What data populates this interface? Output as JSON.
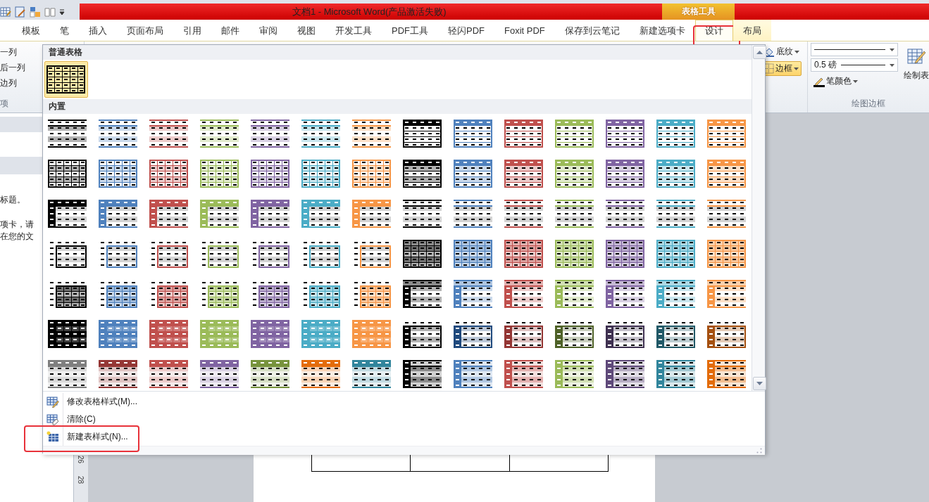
{
  "title_bar": {
    "title": "文档1  -  Microsoft Word(产品激活失败)",
    "contextual_label": "表格工具"
  },
  "tabs": [
    {
      "label": "模板",
      "selected": false,
      "contextual": false,
      "highlighted": false
    },
    {
      "label": "笔",
      "selected": false,
      "contextual": false,
      "highlighted": false
    },
    {
      "label": "插入",
      "selected": false,
      "contextual": false,
      "highlighted": false
    },
    {
      "label": "页面布局",
      "selected": false,
      "contextual": false,
      "highlighted": false
    },
    {
      "label": "引用",
      "selected": false,
      "contextual": false,
      "highlighted": false
    },
    {
      "label": "邮件",
      "selected": false,
      "contextual": false,
      "highlighted": false
    },
    {
      "label": "审阅",
      "selected": false,
      "contextual": false,
      "highlighted": false
    },
    {
      "label": "视图",
      "selected": false,
      "contextual": false,
      "highlighted": false
    },
    {
      "label": "开发工具",
      "selected": false,
      "contextual": false,
      "highlighted": false
    },
    {
      "label": "PDF工具",
      "selected": false,
      "contextual": false,
      "highlighted": false
    },
    {
      "label": "轻闪PDF",
      "selected": false,
      "contextual": false,
      "highlighted": false
    },
    {
      "label": "Foxit PDF",
      "selected": false,
      "contextual": false,
      "highlighted": false
    },
    {
      "label": "保存到云笔记",
      "selected": false,
      "contextual": false,
      "highlighted": false
    },
    {
      "label": "新建选项卡",
      "selected": false,
      "contextual": false,
      "highlighted": false
    },
    {
      "label": "设计",
      "selected": true,
      "contextual": true,
      "highlighted": true
    },
    {
      "label": "布局",
      "selected": false,
      "contextual": true,
      "highlighted": false
    }
  ],
  "ribbon": {
    "left_options": [
      "一列",
      "后一列",
      "边列"
    ],
    "left_group_label": "项",
    "shading_button": "底纹",
    "borders_button": {
      "label": "边框",
      "active": true
    },
    "line_weight": "0.5 磅",
    "pen_color": "笔颜色",
    "draw_table": "绘制表",
    "group_label": "绘图边框"
  },
  "task_pane": {
    "lines": [
      "标题。",
      "项卡，请",
      "在您的文"
    ]
  },
  "ruler": [
    "26",
    "28"
  ],
  "gallery": {
    "plain_header": "普通表格",
    "plain_items": [
      {
        "kind": "plain",
        "color": "#000000",
        "selected": true
      }
    ],
    "builtin_header": "内置",
    "rows": [
      {
        "items": [
          {
            "kind": "shading",
            "color": "#000000",
            "selected": false
          },
          {
            "kind": "shading",
            "color": "#4f81bd",
            "selected": false
          },
          {
            "kind": "shading",
            "color": "#c0504d",
            "selected": false
          },
          {
            "kind": "shading",
            "color": "#9bbb59",
            "selected": false
          },
          {
            "kind": "shading",
            "color": "#8064a2",
            "selected": false
          },
          {
            "kind": "shading",
            "color": "#4bacc6",
            "selected": false
          },
          {
            "kind": "shading",
            "color": "#f79646",
            "selected": false
          },
          {
            "kind": "list",
            "color": "#000000",
            "selected": false
          },
          {
            "kind": "list",
            "color": "#4f81bd",
            "selected": false
          },
          {
            "kind": "list",
            "color": "#c0504d",
            "selected": false
          },
          {
            "kind": "list",
            "color": "#9bbb59",
            "selected": false
          },
          {
            "kind": "list",
            "color": "#8064a2",
            "selected": false
          },
          {
            "kind": "list",
            "color": "#4bacc6",
            "selected": false
          },
          {
            "kind": "list",
            "color": "#f79646",
            "selected": false
          }
        ]
      },
      {
        "items": [
          {
            "kind": "grid",
            "color": "#000000",
            "selected": false
          },
          {
            "kind": "grid",
            "color": "#4f81bd",
            "selected": false
          },
          {
            "kind": "grid",
            "color": "#c0504d",
            "selected": false
          },
          {
            "kind": "grid",
            "color": "#9bbb59",
            "selected": false
          },
          {
            "kind": "grid",
            "color": "#8064a2",
            "selected": false
          },
          {
            "kind": "grid",
            "color": "#4bacc6",
            "selected": false
          },
          {
            "kind": "grid",
            "color": "#f79646",
            "selected": false
          },
          {
            "kind": "header",
            "color": "#000000",
            "selected": false
          },
          {
            "kind": "header",
            "color": "#4f81bd",
            "selected": false
          },
          {
            "kind": "header",
            "color": "#c0504d",
            "selected": false
          },
          {
            "kind": "header",
            "color": "#9bbb59",
            "selected": false
          },
          {
            "kind": "header",
            "color": "#8064a2",
            "selected": false
          },
          {
            "kind": "header",
            "color": "#4bacc6",
            "selected": false
          },
          {
            "kind": "header",
            "color": "#f79646",
            "selected": false
          }
        ]
      },
      {
        "items": [
          {
            "kind": "side",
            "color": "#000000",
            "selected": false
          },
          {
            "kind": "side",
            "color": "#4f81bd",
            "selected": false
          },
          {
            "kind": "side",
            "color": "#c0504d",
            "selected": false
          },
          {
            "kind": "side",
            "color": "#9bbb59",
            "selected": false
          },
          {
            "kind": "side",
            "color": "#8064a2",
            "selected": false
          },
          {
            "kind": "side",
            "color": "#4bacc6",
            "selected": false
          },
          {
            "kind": "side",
            "color": "#f79646",
            "selected": false
          },
          {
            "kind": "lines",
            "color": "#000000",
            "selected": false
          },
          {
            "kind": "lines",
            "color": "#4f81bd",
            "selected": false
          },
          {
            "kind": "lines",
            "color": "#c0504d",
            "selected": false
          },
          {
            "kind": "lines",
            "color": "#9bbb59",
            "selected": false
          },
          {
            "kind": "lines",
            "color": "#8064a2",
            "selected": false
          },
          {
            "kind": "lines",
            "color": "#4bacc6",
            "selected": false
          },
          {
            "kind": "lines",
            "color": "#f79646",
            "selected": false
          }
        ]
      },
      {
        "items": [
          {
            "kind": "corner",
            "color": "#000000",
            "selected": false
          },
          {
            "kind": "corner",
            "color": "#4f81bd",
            "selected": false
          },
          {
            "kind": "corner",
            "color": "#c0504d",
            "selected": false
          },
          {
            "kind": "corner",
            "color": "#9bbb59",
            "selected": false
          },
          {
            "kind": "corner",
            "color": "#8064a2",
            "selected": false
          },
          {
            "kind": "corner",
            "color": "#4bacc6",
            "selected": false
          },
          {
            "kind": "corner",
            "color": "#f79646",
            "selected": false
          },
          {
            "kind": "medium",
            "color": "#000000",
            "selected": false
          },
          {
            "kind": "medium",
            "color": "#4f81bd",
            "selected": false
          },
          {
            "kind": "medium",
            "color": "#c0504d",
            "selected": false
          },
          {
            "kind": "medium",
            "color": "#9bbb59",
            "selected": false
          },
          {
            "kind": "medium",
            "color": "#8064a2",
            "selected": false
          },
          {
            "kind": "medium",
            "color": "#4bacc6",
            "selected": false
          },
          {
            "kind": "medium",
            "color": "#f79646",
            "selected": false
          }
        ]
      },
      {
        "items": [
          {
            "kind": "cornerfill",
            "color": "#000000",
            "selected": false
          },
          {
            "kind": "cornerfill",
            "color": "#4f81bd",
            "selected": false
          },
          {
            "kind": "cornerfill",
            "color": "#c0504d",
            "selected": false
          },
          {
            "kind": "cornerfill",
            "color": "#9bbb59",
            "selected": false
          },
          {
            "kind": "cornerfill",
            "color": "#8064a2",
            "selected": false
          },
          {
            "kind": "cornerfill",
            "color": "#4bacc6",
            "selected": false
          },
          {
            "kind": "cornerfill",
            "color": "#f79646",
            "selected": false
          },
          {
            "kind": "sidedark",
            "color": "#000000",
            "selected": false
          },
          {
            "kind": "sidedark",
            "color": "#4f81bd",
            "selected": false
          },
          {
            "kind": "sidedark",
            "color": "#c0504d",
            "selected": false
          },
          {
            "kind": "sidedark",
            "color": "#9bbb59",
            "selected": false
          },
          {
            "kind": "sidedark",
            "color": "#8064a2",
            "selected": false
          },
          {
            "kind": "sidedark",
            "color": "#4bacc6",
            "selected": false
          },
          {
            "kind": "sidedark",
            "color": "#f79646",
            "selected": false
          }
        ]
      },
      {
        "items": [
          {
            "kind": "filled",
            "color": "#000000",
            "selected": false
          },
          {
            "kind": "filled",
            "color": "#4f81bd",
            "selected": false
          },
          {
            "kind": "filled",
            "color": "#c0504d",
            "selected": false
          },
          {
            "kind": "filled",
            "color": "#9bbb59",
            "selected": false
          },
          {
            "kind": "filled",
            "color": "#8064a2",
            "selected": false
          },
          {
            "kind": "filled",
            "color": "#4bacc6",
            "selected": false
          },
          {
            "kind": "filled",
            "color": "#f79646",
            "selected": false
          },
          {
            "kind": "sideoutline",
            "color": "#000000",
            "selected": false
          },
          {
            "kind": "sideoutline",
            "color": "#1f497d",
            "selected": false
          },
          {
            "kind": "sideoutline",
            "color": "#943634",
            "selected": false
          },
          {
            "kind": "sideoutline",
            "color": "#4f6228",
            "selected": false
          },
          {
            "kind": "sideoutline",
            "color": "#3f3151",
            "selected": false
          },
          {
            "kind": "sideoutline",
            "color": "#215967",
            "selected": false
          },
          {
            "kind": "sideoutline",
            "color": "#a5500f",
            "selected": false
          }
        ]
      },
      {
        "items": [
          {
            "kind": "stripe",
            "color": "#7f7f7f",
            "selected": false
          },
          {
            "kind": "stripe",
            "color": "#953735",
            "selected": false
          },
          {
            "kind": "stripe",
            "color": "#c0504d",
            "selected": false
          },
          {
            "kind": "stripe",
            "color": "#8064a2",
            "selected": false
          },
          {
            "kind": "stripe",
            "color": "#77933c",
            "selected": false
          },
          {
            "kind": "stripe",
            "color": "#e46c0a",
            "selected": false
          },
          {
            "kind": "stripe",
            "color": "#31859c",
            "selected": false
          },
          {
            "kind": "sidebanded",
            "color": "#000000",
            "selected": false
          },
          {
            "kind": "sidebanded",
            "color": "#4f81bd",
            "selected": false
          },
          {
            "kind": "sidebanded",
            "color": "#c0504d",
            "selected": false
          },
          {
            "kind": "sidebanded",
            "color": "#9bbb59",
            "selected": false
          },
          {
            "kind": "sidebanded",
            "color": "#5f497a",
            "selected": false
          },
          {
            "kind": "sidebanded",
            "color": "#31859c",
            "selected": false
          },
          {
            "kind": "sidebanded",
            "color": "#e36c09",
            "selected": false
          }
        ]
      }
    ]
  },
  "menu": [
    {
      "label": "修改表格样式(M)...",
      "kind": "modify",
      "highlighted": false
    },
    {
      "label": "清除(C)",
      "kind": "clear",
      "highlighted": false
    },
    {
      "label": "新建表样式(N)...",
      "kind": "new",
      "highlighted": true
    }
  ]
}
